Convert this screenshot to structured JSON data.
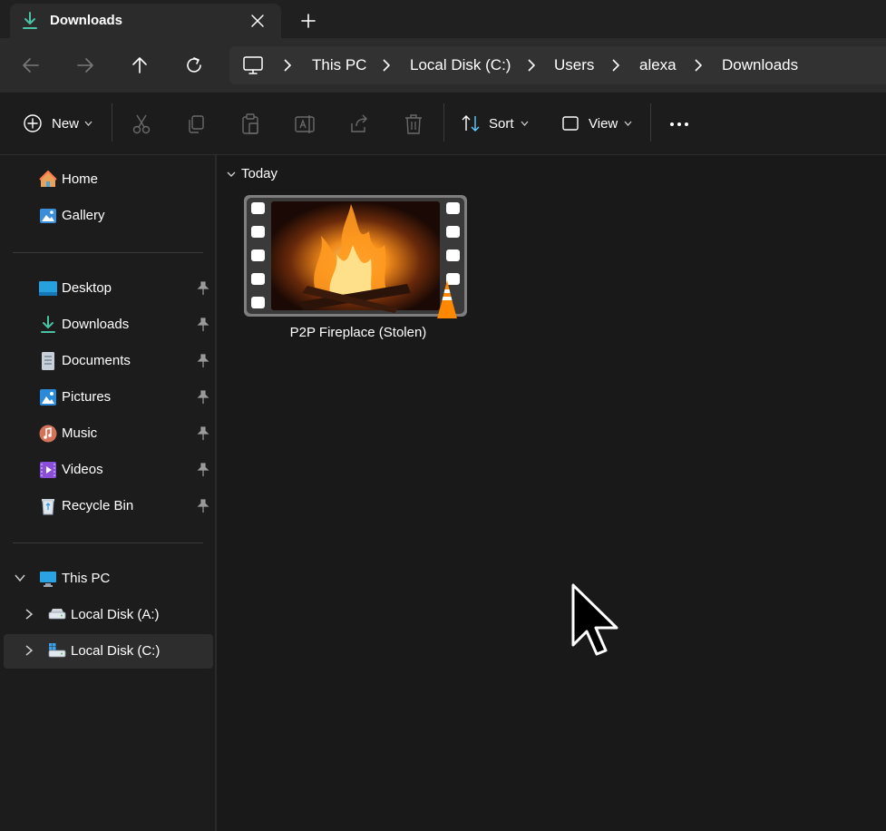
{
  "tab": {
    "title": "Downloads",
    "icon": "download-icon",
    "close_icon": "close-icon",
    "new_tab_icon": "plus-icon"
  },
  "nav": {
    "back_icon": "arrow-left-icon",
    "forward_icon": "arrow-right-icon",
    "up_icon": "arrow-up-icon",
    "refresh_icon": "refresh-icon"
  },
  "breadcrumb": [
    "This PC",
    "Local Disk (C:)",
    "Users",
    "alexa",
    "Downloads"
  ],
  "toolbar": {
    "new_label": "New",
    "sort_label": "Sort",
    "view_label": "View",
    "icons": [
      "cut-icon",
      "copy-icon",
      "paste-icon",
      "rename-icon",
      "share-icon",
      "delete-icon",
      "more-icon"
    ]
  },
  "sidebar": {
    "quick": [
      {
        "label": "Home",
        "icon": "home-icon"
      },
      {
        "label": "Gallery",
        "icon": "gallery-icon"
      }
    ],
    "pinned": [
      {
        "label": "Desktop",
        "icon": "desktop-icon"
      },
      {
        "label": "Downloads",
        "icon": "download-icon"
      },
      {
        "label": "Documents",
        "icon": "documents-icon"
      },
      {
        "label": "Pictures",
        "icon": "pictures-icon"
      },
      {
        "label": "Music",
        "icon": "music-icon"
      },
      {
        "label": "Videos",
        "icon": "videos-icon"
      },
      {
        "label": "Recycle Bin",
        "icon": "recycle-bin-icon"
      }
    ],
    "this_pc": {
      "label": "This PC",
      "icon": "monitor-icon"
    },
    "drives": [
      {
        "label": "Local Disk (A:)",
        "icon": "drive-icon",
        "selected": false
      },
      {
        "label": "Local Disk (C:)",
        "icon": "system-drive-icon",
        "selected": true
      }
    ]
  },
  "content": {
    "group_label": "Today",
    "files": [
      {
        "name": "P2P Fireplace (Stolen)",
        "type_icon": "vlc-cone-icon"
      }
    ]
  },
  "colors": {
    "accent": "#60cdff",
    "download_green": "#4cc2a4",
    "vlc_orange": "#ff8800"
  }
}
